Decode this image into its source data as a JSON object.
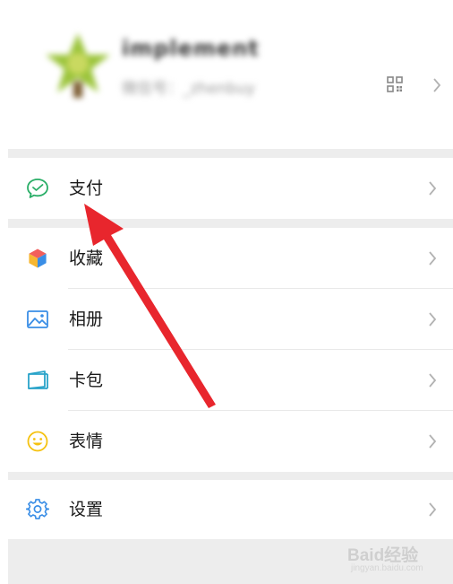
{
  "profile": {
    "name": "implement",
    "id_text": "微信号：_zhenbuy"
  },
  "menu": {
    "pay": "支付",
    "favorites": "收藏",
    "album": "相册",
    "cards": "卡包",
    "stickers": "表情",
    "settings": "设置"
  },
  "watermark": {
    "brand": "Baid经验",
    "sub": "jingyan.baidu.com"
  },
  "colors": {
    "pay_green": "#2aae67",
    "annotation_red": "#e8262d",
    "gap_gray": "#ededed"
  },
  "icons": {
    "pay": "wechat-pay-icon",
    "favorites": "cube-icon",
    "album": "image-icon",
    "cards": "card-wallet-icon",
    "stickers": "smiley-icon",
    "settings": "gear-icon"
  }
}
